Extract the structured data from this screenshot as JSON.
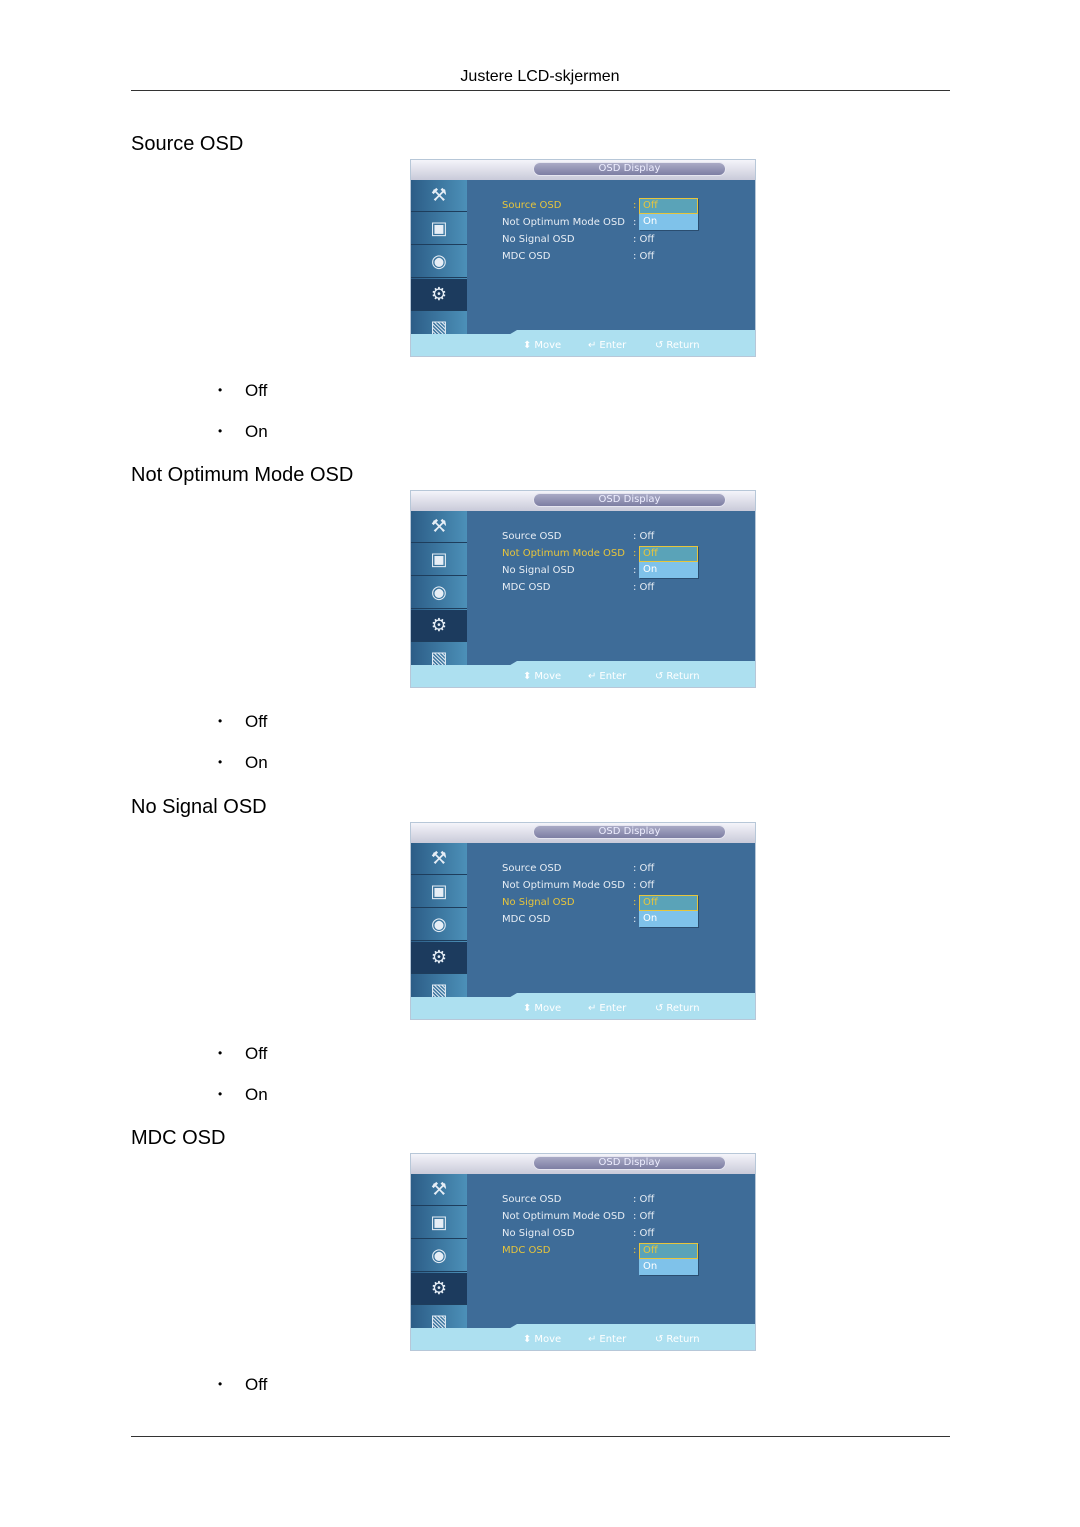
{
  "page": {
    "header_title": "Justere LCD-skjermen"
  },
  "osd_common": {
    "title": "OSD Display",
    "sidebar_icons": [
      "input-icon",
      "picture-icon",
      "sound-icon",
      "setup-gear-icon",
      "multi-control-icon"
    ],
    "sidebar_glyphs": [
      "⚒",
      "▣",
      "◉",
      "⚙",
      "▧"
    ],
    "active_sidebar_index": 3,
    "menu_items": [
      {
        "label": "Source OSD"
      },
      {
        "label": "Not Optimum Mode OSD"
      },
      {
        "label": "No Signal OSD"
      },
      {
        "label": "MDC OSD"
      }
    ],
    "hints": {
      "move_glyph": "⬍",
      "move": "Move",
      "enter_glyph": "↵",
      "enter": "Enter",
      "return_glyph": "↺",
      "return": "Return"
    },
    "dropdown_options": [
      "Off",
      "On"
    ],
    "value_prefix": ": ",
    "colon": ":"
  },
  "sections": [
    {
      "heading": "Source OSD",
      "selected_index": 0,
      "values": [
        "Off",
        "Off",
        "Off",
        "Off"
      ],
      "bullets": [
        "Off",
        "On"
      ]
    },
    {
      "heading": "Not Optimum Mode OSD",
      "selected_index": 1,
      "values": [
        "Off",
        "Off",
        "Off",
        "Off"
      ],
      "bullets": [
        "Off",
        "On"
      ]
    },
    {
      "heading": "No Signal OSD",
      "selected_index": 2,
      "values": [
        "Off",
        "Off",
        "Off",
        "Off"
      ],
      "bullets": [
        "Off",
        "On"
      ]
    },
    {
      "heading": "MDC OSD",
      "selected_index": 3,
      "values": [
        "Off",
        "Off",
        "Off",
        "Off"
      ],
      "bullets": [
        "Off"
      ]
    }
  ],
  "bullet_glyph": "•"
}
